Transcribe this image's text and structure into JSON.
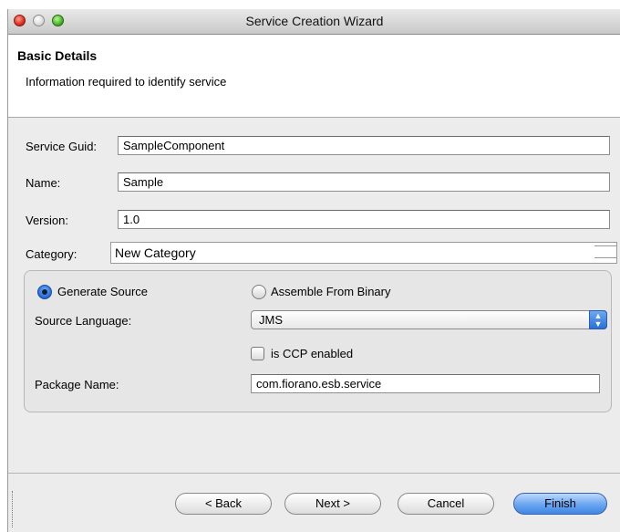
{
  "window": {
    "title": "Service Creation Wizard"
  },
  "header": {
    "title": "Basic Details",
    "description": "Information required to identify service"
  },
  "form": {
    "service_guid": {
      "label": "Service Guid:",
      "value": "SampleComponent"
    },
    "name": {
      "label": "Name:",
      "value": "Sample"
    },
    "version": {
      "label": "Version:",
      "value": "1.0"
    },
    "category": {
      "label": "Category:",
      "value": "New Category"
    }
  },
  "source": {
    "generate_label": "Generate Source",
    "assemble_label": "Assemble From Binary",
    "selected": "Generate Source",
    "language_label": "Source Language:",
    "language_value": "JMS",
    "ccp_label": "is CCP enabled",
    "ccp_checked": false,
    "package_label": "Package Name:",
    "package_value": "com.fiorano.esb.service"
  },
  "buttons": {
    "back": "< Back",
    "next": "Next >",
    "cancel": "Cancel",
    "finish": "Finish"
  },
  "colors": {
    "accent": "#3f86e6",
    "close": "#d42a1a",
    "zoom": "#3fae1f"
  }
}
